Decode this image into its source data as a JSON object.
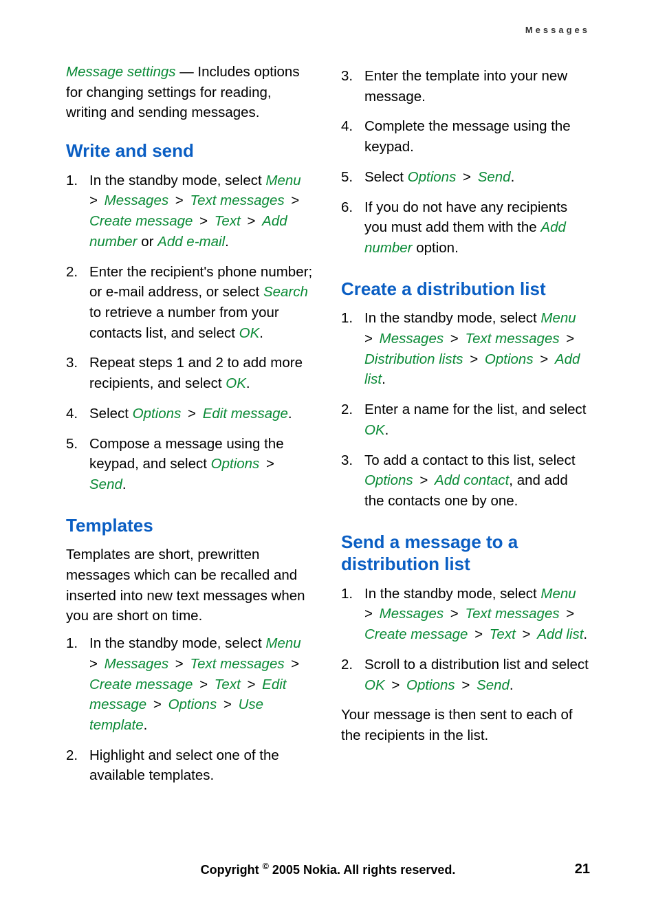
{
  "header": {
    "section_name": "Messages"
  },
  "footer": {
    "copyright_pre": "Copyright ",
    "copyright_sym": "©",
    "copyright_post": " 2005 Nokia. All rights reserved.",
    "page_number": "21"
  },
  "left": {
    "intro": {
      "em": "Message settings",
      "rest": " — Includes options for changing settings for reading, writing and sending messages."
    },
    "write_heading": "Write and send",
    "write_steps": {
      "s1_a": "In the standby mode, select ",
      "s1_menu": "Menu",
      "gt": " > ",
      "s1_messages": "Messages",
      "s1_text_messages": "Text messages",
      "s1_create": "Create message",
      "s1_text": "Text",
      "s1_addnum": "Add number",
      "s1_or": " or ",
      "s1_addemail": "Add e-mail",
      "s1_period": ".",
      "s2_a": "Enter the recipient's phone number; or e-mail address, or select ",
      "s2_search": "Search",
      "s2_b": " to retrieve a number from your contacts list, and select ",
      "s2_ok": "OK",
      "s2_period": ".",
      "s3_a": "Repeat steps 1 and 2 to add more recipients, and select ",
      "s3_ok": "OK",
      "s3_period": ".",
      "s4_a": "Select ",
      "s4_options": "Options",
      "s4_edit": "Edit message",
      "s4_period": ".",
      "s5_a": "Compose a message using the keypad, and select ",
      "s5_options": "Options",
      "s5_send": "Send",
      "s5_period": "."
    },
    "templates_heading": "Templates",
    "templates_intro": "Templates are short, prewritten messages which can be recalled and inserted into new text messages when you are short on time.",
    "templates_steps": {
      "s1_a": "In the standby mode, select ",
      "menu": "Menu",
      "gt": " > ",
      "messages": "Messages",
      "text_messages": "Text messages",
      "create": "Create message",
      "text": "Text",
      "edit": "Edit message",
      "options": "Options",
      "use_template": "Use template",
      "period": ".",
      "s2": "Highlight and select one of the available templates."
    }
  },
  "right": {
    "cont_steps": {
      "s3": "Enter the template into your new message.",
      "s4": "Complete the message using the keypad.",
      "s5_a": "Select ",
      "s5_options": "Options",
      "gt": " > ",
      "s5_send": "Send",
      "s5_period": ".",
      "s6_a": "If you do not have any recipients you must add them with the ",
      "s6_addnum": "Add number",
      "s6_b": " option."
    },
    "dist_heading": "Create a distribution list",
    "dist_steps": {
      "s1_a": "In the standby mode, select ",
      "menu": "Menu",
      "gt": " > ",
      "messages": "Messages",
      "text_messages": "Text messages",
      "dist_lists": "Distribution lists",
      "options": "Options",
      "add_list": "Add list",
      "period": ".",
      "s2_a": "Enter a name for the list, and select ",
      "s2_ok": "OK",
      "s2_period": ".",
      "s3_a": "To add a contact to this list, select ",
      "s3_options": "Options",
      "s3_addcontact": "Add contact",
      "s3_b": ", and add the contacts one by one."
    },
    "send_heading": "Send a message to a distribution list",
    "send_steps": {
      "s1_a": "In the standby mode, select ",
      "menu": "Menu",
      "gt": " > ",
      "messages": "Messages",
      "text_messages": "Text messages",
      "create": "Create message",
      "text": "Text",
      "add_list": "Add list",
      "period": ".",
      "s2_a": "Scroll to a distribution list and select ",
      "s2_ok": "OK",
      "s2_options": "Options",
      "s2_send": "Send",
      "s2_period": "."
    },
    "send_outro": "Your message is then sent to each of the recipients in the list."
  }
}
